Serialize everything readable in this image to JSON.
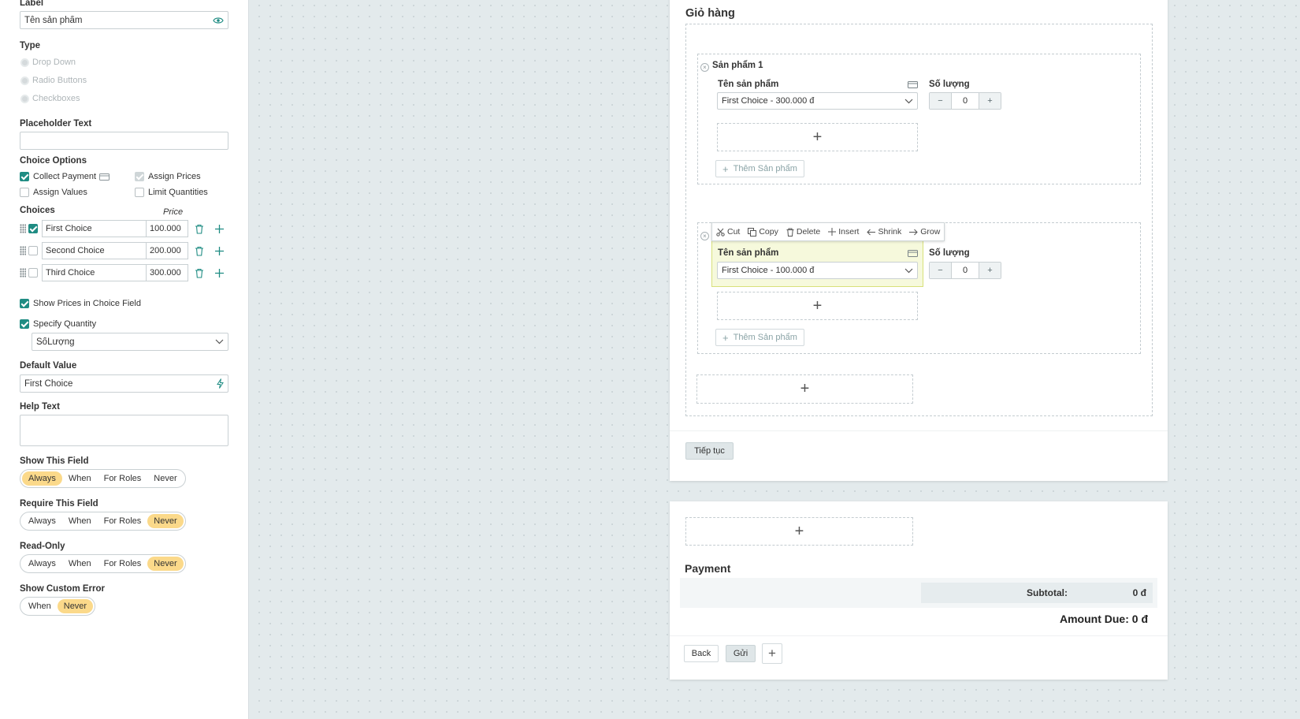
{
  "left_panel": {
    "label": {
      "heading": "Label",
      "value": "Tên sản phẩm"
    },
    "type": {
      "heading": "Type",
      "options": [
        "Drop Down",
        "Radio Buttons",
        "Checkboxes"
      ]
    },
    "placeholder": {
      "heading": "Placeholder Text",
      "value": ""
    },
    "choice_options": {
      "heading": "Choice Options",
      "collect_payment": "Collect Payment",
      "assign_prices": "Assign Prices",
      "assign_values": "Assign Values",
      "limit_quantities": "Limit Quantities"
    },
    "choices": {
      "heading": "Choices",
      "price_heading": "Price",
      "items": [
        {
          "label": "First Choice",
          "price": "100.000",
          "checked": true
        },
        {
          "label": "Second Choice",
          "price": "200.000",
          "checked": false
        },
        {
          "label": "Third Choice",
          "price": "300.000",
          "checked": false
        }
      ]
    },
    "show_prices": "Show Prices in Choice Field",
    "specify_quantity": "Specify Quantity",
    "quantity_field": "SốLượng",
    "default_value": {
      "heading": "Default Value",
      "value": "First Choice"
    },
    "help_text": {
      "heading": "Help Text",
      "value": ""
    },
    "show_field": {
      "heading": "Show This Field",
      "options": [
        "Always",
        "When",
        "For Roles",
        "Never"
      ],
      "selected": "Always"
    },
    "require_field": {
      "heading": "Require This Field",
      "options": [
        "Always",
        "When",
        "For Roles",
        "Never"
      ],
      "selected": "Never"
    },
    "read_only": {
      "heading": "Read-Only",
      "options": [
        "Always",
        "When",
        "For Roles",
        "Never"
      ],
      "selected": "Never"
    },
    "custom_error": {
      "heading": "Show Custom Error",
      "options": [
        "When",
        "Never"
      ],
      "selected": "Never"
    }
  },
  "form": {
    "section_title": "Giỏ hàng",
    "product1": {
      "title": "Sản phẩm 1",
      "name_label": "Tên sản phẩm",
      "name_value": "First Choice - 300.000 đ",
      "qty_label": "Số lượng",
      "qty_value": "0",
      "add_label": "Thêm Sản phẩm"
    },
    "product2": {
      "name_label": "Tên sản phẩm",
      "name_value": "First Choice - 100.000 đ",
      "qty_label": "Số lượng",
      "qty_value": "0",
      "add_label": "Thêm Sản phẩm"
    },
    "toolbar": {
      "cut": "Cut",
      "copy": "Copy",
      "delete": "Delete",
      "insert": "Insert",
      "shrink": "Shrink",
      "grow": "Grow"
    },
    "continue_label": "Tiếp tục",
    "payment_title": "Payment",
    "subtotal_label": "Subtotal:",
    "subtotal_value": "0 đ",
    "amount_due": "Amount Due: 0 đ",
    "back_label": "Back",
    "submit_label": "Gửi"
  },
  "colors": {
    "accent": "#1f8c83",
    "selected_pill": "#fbd98a",
    "selected_field": "#f6f9dc"
  }
}
